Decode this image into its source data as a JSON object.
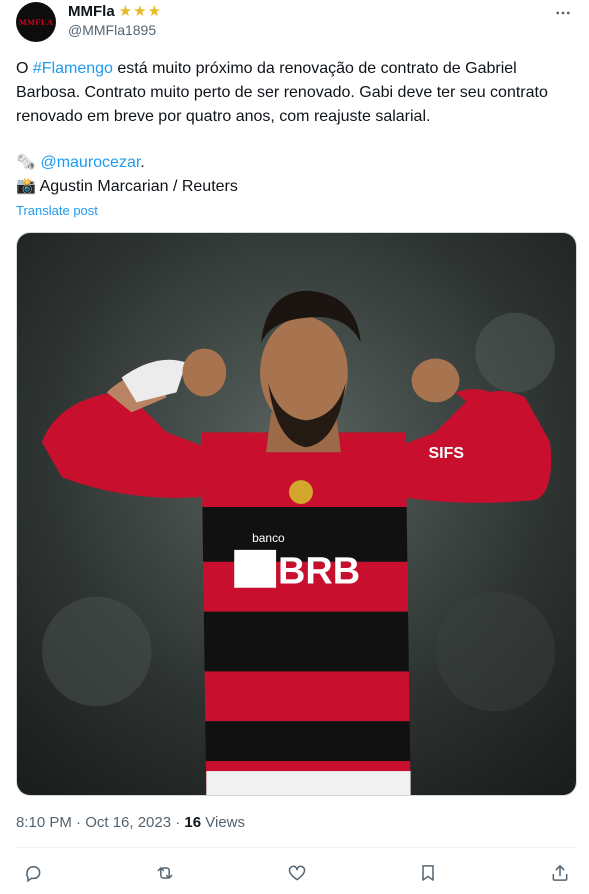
{
  "post": {
    "author_name": "MMFla",
    "author_handle": "@MMFla1895",
    "avatar_text": "MMFLA",
    "verified_stars": "★★★",
    "text_pre": "O ",
    "hashtag": "#Flamengo",
    "text_post": " está muito próximo da renovação de contrato de Gabriel Barbosa. Contrato muito perto de ser renovado. Gabi deve ter seu contrato renovado em breve por quatro anos, com reajuste salarial.",
    "source_emoji": "🗞️",
    "source_mention": "@maurocezar",
    "source_period": ".",
    "photo_emoji": "📸",
    "photo_credit": "Agustin Marcarian / Reuters",
    "translate_label": "Translate post",
    "timestamp": "8:10 PM · Oct 16, 2023 · ",
    "views_count": "16",
    "views_label": " Views",
    "image_jersey_sponsor_top": "banco",
    "image_jersey_sponsor": "BRB",
    "image_sleeve_text": "SIFS"
  },
  "actions": [
    "reply-icon",
    "retweet-icon",
    "like-icon",
    "bookmark-icon",
    "share-icon"
  ],
  "colors": {
    "link": "#1d9bf0",
    "text": "#0f1419",
    "muted": "#536471",
    "jersey_red": "#c8102e",
    "jersey_black": "#111111"
  }
}
